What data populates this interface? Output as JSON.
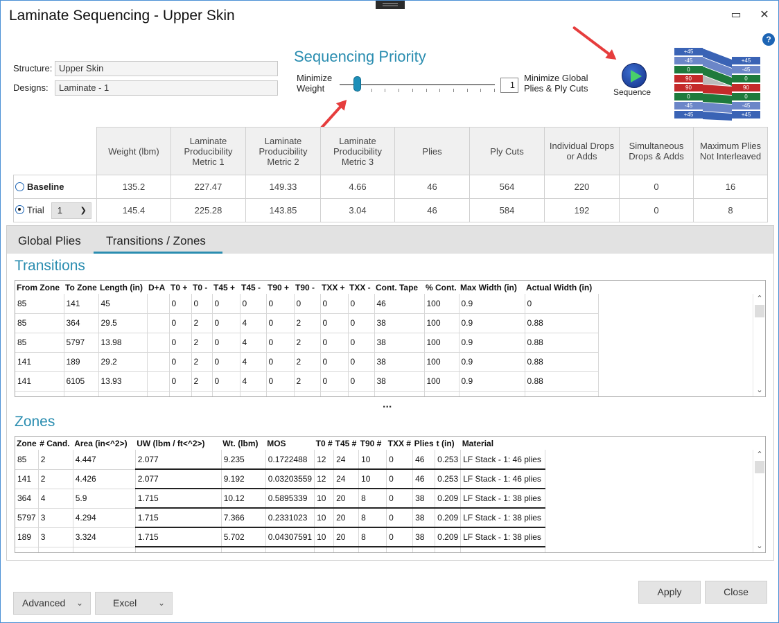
{
  "window": {
    "title": "Laminate Sequencing - Upper Skin",
    "maximize_glyph": "▭",
    "close_glyph": "✕",
    "help_glyph": "?"
  },
  "structure": {
    "label": "Structure:",
    "value": "Upper Skin"
  },
  "designs": {
    "label": "Designs:",
    "value": "Laminate - 1"
  },
  "priority": {
    "title": "Sequencing Priority",
    "left_label_line1": "Minimize",
    "left_label_line2": "Weight",
    "right_label_line1": "Minimize Global",
    "right_label_line2": "Plies & Ply Cuts",
    "value": "1",
    "slider_fraction": 0.11
  },
  "sequence": {
    "label": "Sequence"
  },
  "stack_preview": {
    "left": [
      {
        "t": "+45",
        "c": "#3a63b5"
      },
      {
        "t": "-45",
        "c": "#6b86c8"
      },
      {
        "t": "0",
        "c": "#1e7a3c"
      },
      {
        "t": "90",
        "c": "#c42a2a"
      },
      {
        "t": "90",
        "c": "#c42a2a"
      },
      {
        "t": "0",
        "c": "#1e7a3c"
      },
      {
        "t": "-45",
        "c": "#6b86c8"
      },
      {
        "t": "+45",
        "c": "#3a63b5"
      }
    ],
    "right": [
      {
        "t": "+45",
        "c": "#3a63b5"
      },
      {
        "t": "-45",
        "c": "#6b86c8"
      },
      {
        "t": "0",
        "c": "#1e7a3c"
      },
      {
        "t": "90",
        "c": "#c42a2a"
      },
      {
        "t": "0",
        "c": "#1e7a3c"
      },
      {
        "t": "-45",
        "c": "#6b86c8"
      },
      {
        "t": "+45",
        "c": "#3a63b5"
      }
    ]
  },
  "metrics": {
    "headers": [
      "Weight (lbm)",
      "Laminate Producibility Metric 1",
      "Laminate Producibility Metric 2",
      "Laminate Producibility Metric 3",
      "Plies",
      "Ply Cuts",
      "Individual Drops or Adds",
      "Simultaneous Drops & Adds",
      "Maximum Plies Not Interleaved"
    ],
    "baseline": {
      "label": "Baseline",
      "values": [
        "135.2",
        "227.47",
        "149.33",
        "4.66",
        "46",
        "564",
        "220",
        "0",
        "16"
      ]
    },
    "trial": {
      "label": "Trial",
      "selected": "1",
      "values": [
        "145.4",
        "225.28",
        "143.85",
        "3.04",
        "46",
        "584",
        "192",
        "0",
        "8"
      ]
    }
  },
  "tabs": [
    {
      "label": "Global Plies"
    },
    {
      "label": "Transitions / Zones"
    }
  ],
  "transitions": {
    "title": "Transitions",
    "columns": [
      "From Zone",
      "To Zone",
      "Length (in)",
      "D+A",
      "T0 +",
      "T0 -",
      "T45 +",
      "T45 -",
      "T90 +",
      "T90 -",
      "TXX +",
      "TXX -",
      "Cont. Tape",
      "% Cont.",
      "Max Width (in)",
      "Actual Width (in)"
    ],
    "rows": [
      [
        "85",
        "141",
        "45",
        "",
        "0",
        "0",
        "0",
        "0",
        "0",
        "0",
        "0",
        "0",
        "46",
        "100",
        "0.9",
        "0"
      ],
      [
        "85",
        "364",
        "29.5",
        "",
        "0",
        "2",
        "0",
        "4",
        "0",
        "2",
        "0",
        "0",
        "38",
        "100",
        "0.9",
        "0.88"
      ],
      [
        "85",
        "5797",
        "13.98",
        "",
        "0",
        "2",
        "0",
        "4",
        "0",
        "2",
        "0",
        "0",
        "38",
        "100",
        "0.9",
        "0.88"
      ],
      [
        "141",
        "189",
        "29.2",
        "",
        "0",
        "2",
        "0",
        "4",
        "0",
        "2",
        "0",
        "0",
        "38",
        "100",
        "0.9",
        "0.88"
      ],
      [
        "141",
        "6105",
        "13.93",
        "",
        "0",
        "2",
        "0",
        "4",
        "0",
        "2",
        "0",
        "0",
        "38",
        "100",
        "0.9",
        "0.88"
      ]
    ]
  },
  "splitter": "...",
  "zones": {
    "title": "Zones",
    "columns": [
      "Zone",
      "# Cand.",
      "Area (in<^2>)",
      "UW (lbm / ft<^2>)",
      "Wt. (lbm)",
      "MOS",
      "T0 #",
      "T45 #",
      "T90 #",
      "TXX #",
      "Plies",
      "t (in)",
      "Material"
    ],
    "rows": [
      [
        "85",
        "2",
        "4.447",
        "2.077",
        "9.235",
        "0.1722488",
        "12",
        "24",
        "10",
        "0",
        "46",
        "0.253",
        "LF Stack - 1: 46 plies"
      ],
      [
        "141",
        "2",
        "4.426",
        "2.077",
        "9.192",
        "0.03203559",
        "12",
        "24",
        "10",
        "0",
        "46",
        "0.253",
        "LF Stack - 1: 46 plies"
      ],
      [
        "364",
        "4",
        "5.9",
        "1.715",
        "10.12",
        "0.5895339",
        "10",
        "20",
        "8",
        "0",
        "38",
        "0.209",
        "LF Stack - 1: 38 plies"
      ],
      [
        "5797",
        "3",
        "4.294",
        "1.715",
        "7.366",
        "0.2331023",
        "10",
        "20",
        "8",
        "0",
        "38",
        "0.209",
        "LF Stack - 1: 38 plies"
      ],
      [
        "189",
        "3",
        "3.324",
        "1.715",
        "5.702",
        "0.04307591",
        "10",
        "20",
        "8",
        "0",
        "38",
        "0.209",
        "LF Stack - 1: 38 plies"
      ]
    ]
  },
  "footer": {
    "advanced": "Advanced",
    "excel": "Excel",
    "apply": "Apply",
    "close": "Close"
  }
}
